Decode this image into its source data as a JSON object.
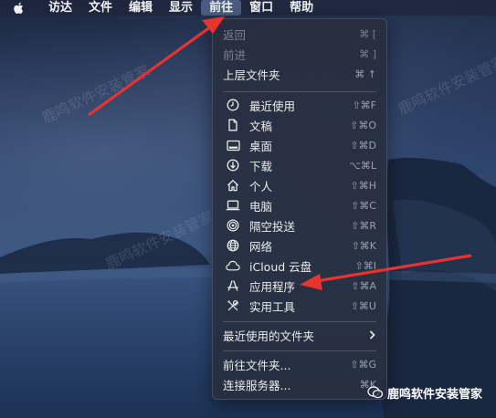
{
  "menubar": {
    "items": [
      {
        "label": "访达"
      },
      {
        "label": "文件"
      },
      {
        "label": "编辑"
      },
      {
        "label": "显示"
      },
      {
        "label": "前往"
      },
      {
        "label": "窗口"
      },
      {
        "label": "帮助"
      }
    ]
  },
  "go_menu": {
    "top_items": [
      {
        "label": "返回",
        "shortcut": "⌘ [",
        "enabled": false
      },
      {
        "label": "前进",
        "shortcut": "⌘ ]",
        "enabled": false
      },
      {
        "label": "上层文件夹",
        "shortcut": "⌘ ↑",
        "enabled": true
      }
    ],
    "places": [
      {
        "label": "最近使用",
        "shortcut": "⇧⌘F",
        "icon": "clock-icon"
      },
      {
        "label": "文稿",
        "shortcut": "⇧⌘O",
        "icon": "document-icon"
      },
      {
        "label": "桌面",
        "shortcut": "⇧⌘D",
        "icon": "desktop-icon"
      },
      {
        "label": "下载",
        "shortcut": "⌥⌘L",
        "icon": "download-icon"
      },
      {
        "label": "个人",
        "shortcut": "⇧⌘H",
        "icon": "home-icon"
      },
      {
        "label": "电脑",
        "shortcut": "⇧⌘C",
        "icon": "laptop-icon"
      },
      {
        "label": "隔空投送",
        "shortcut": "⇧⌘R",
        "icon": "airdrop-icon"
      },
      {
        "label": "网络",
        "shortcut": "⇧⌘K",
        "icon": "globe-icon"
      },
      {
        "label": "iCloud 云盘",
        "shortcut": "⇧⌘I",
        "icon": "cloud-icon"
      },
      {
        "label": "应用程序",
        "shortcut": "⇧⌘A",
        "icon": "applications-icon"
      },
      {
        "label": "实用工具",
        "shortcut": "⇧⌘U",
        "icon": "utilities-icon"
      }
    ],
    "recent_folders": {
      "label": "最近使用的文件夹"
    },
    "bottom_items": [
      {
        "label": "前往文件夹...",
        "shortcut": "⇧⌘G"
      },
      {
        "label": "连接服务器...",
        "shortcut": "⌘K"
      }
    ]
  },
  "watermark": {
    "text": "鹿鸣软件安装管家"
  },
  "colors": {
    "annotation_arrow": "#e8332f",
    "menu_bg": "#282e40"
  }
}
